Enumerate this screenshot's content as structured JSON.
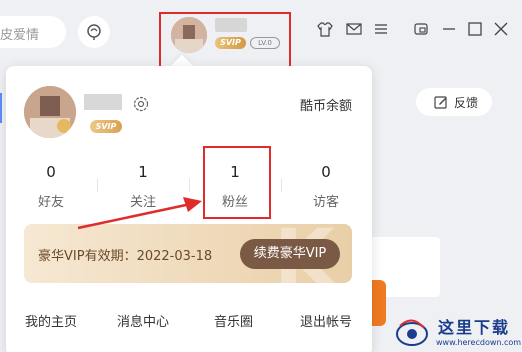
{
  "topbar": {
    "search_placeholder": "皮爱情",
    "level_badge": "LV.0",
    "vip_badge": "SVIP"
  },
  "profile": {
    "vip_badge": "SVIP",
    "coin_label": "酷币余额"
  },
  "stats": [
    {
      "num": "0",
      "label": "好友"
    },
    {
      "num": "1",
      "label": "关注"
    },
    {
      "num": "1",
      "label": "粉丝"
    },
    {
      "num": "0",
      "label": "访客"
    }
  ],
  "vip": {
    "expiry_text": "豪华VIP有效期：2022-03-18",
    "renew_label": "续费豪华VIP"
  },
  "bottom_links": [
    "我的主页",
    "消息中心",
    "音乐圈",
    "退出帐号"
  ],
  "feedback_label": "反馈",
  "watermark": {
    "text": "这里下载",
    "url": "www.herecdown.com"
  },
  "colors": {
    "highlight_red": "#e02b2b",
    "vip_brown": "#7a5a45",
    "svip_gold": "#d9a151"
  }
}
